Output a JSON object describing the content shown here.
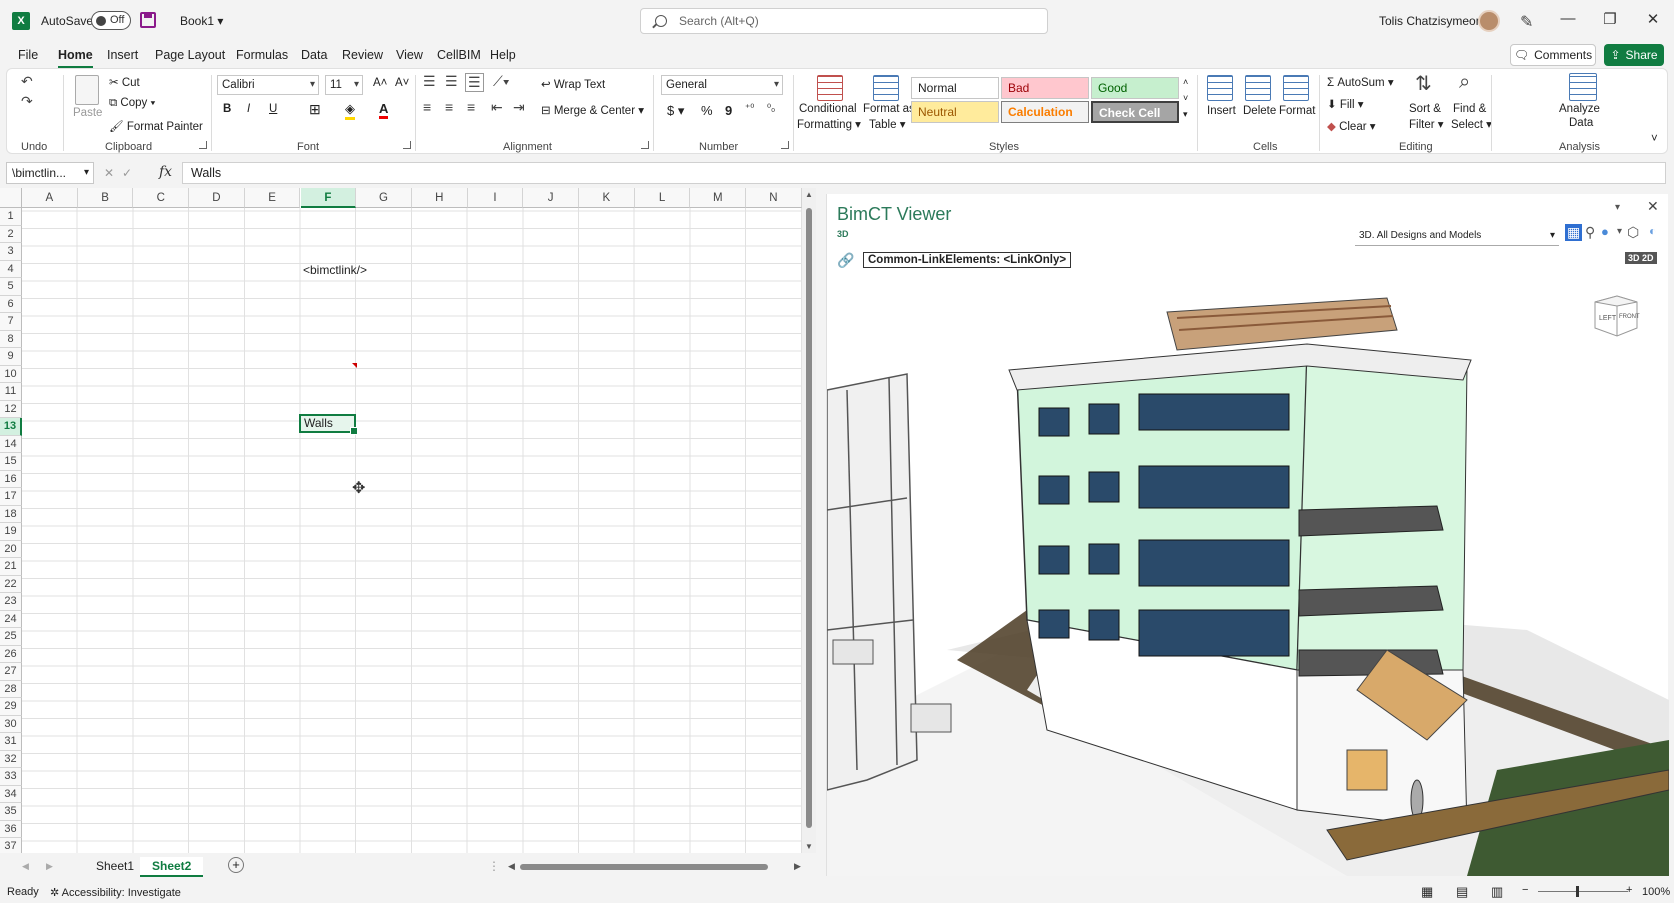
{
  "titlebar": {
    "autosave_label": "AutoSave",
    "autosave_state": "Off",
    "book_title": "Book1",
    "search_placeholder": "Search (Alt+Q)",
    "user_name": "Tolis Chatzisymeon"
  },
  "menu": {
    "tabs": [
      "File",
      "Home",
      "Insert",
      "Page Layout",
      "Formulas",
      "Data",
      "Review",
      "View",
      "CellBIM",
      "Help"
    ],
    "active": "Home",
    "comments_label": "Comments",
    "share_label": "Share"
  },
  "ribbon": {
    "undo_label": "Undo",
    "clipboard": {
      "label": "Clipboard",
      "paste": "Paste",
      "cut": "Cut",
      "copy": "Copy",
      "format_painter": "Format Painter"
    },
    "font": {
      "label": "Font",
      "name": "Calibri",
      "size": "11",
      "bold": "B",
      "italic": "I",
      "underline": "U"
    },
    "alignment": {
      "label": "Alignment",
      "wrap_text": "Wrap Text",
      "merge_center": "Merge & Center"
    },
    "number": {
      "label": "Number",
      "format": "General",
      "currency": "$",
      "percent": "%",
      "comma": "9"
    },
    "styles": {
      "label": "Styles",
      "conditional_1": "Conditional",
      "conditional_2": "Formatting",
      "format_table_1": "Format as",
      "format_table_2": "Table",
      "normal": "Normal",
      "bad": "Bad",
      "good": "Good",
      "neutral": "Neutral",
      "calculation": "Calculation",
      "check_cell": "Check Cell"
    },
    "cells": {
      "label": "Cells",
      "insert": "Insert",
      "delete": "Delete",
      "format": "Format"
    },
    "editing": {
      "label": "Editing",
      "autosum": "AutoSum",
      "fill": "Fill",
      "clear": "Clear",
      "sort_1": "Sort &",
      "sort_2": "Filter",
      "find_1": "Find &",
      "find_2": "Select"
    },
    "analysis": {
      "label": "Analysis",
      "analyze_1": "Analyze",
      "analyze_2": "Data"
    }
  },
  "formula_bar": {
    "name_box": "\\bimctlin...",
    "fx": "fx",
    "value": "Walls"
  },
  "grid": {
    "columns": [
      "A",
      "B",
      "C",
      "D",
      "E",
      "F",
      "G",
      "H",
      "I",
      "J",
      "K",
      "L",
      "M",
      "N"
    ],
    "selected_column": "F",
    "rows": [
      "1",
      "2",
      "3",
      "4",
      "5",
      "6",
      "7",
      "8",
      "9",
      "10",
      "11",
      "12",
      "13",
      "14",
      "15",
      "16",
      "17",
      "18",
      "19",
      "20",
      "21",
      "22",
      "23",
      "24",
      "25",
      "26",
      "27",
      "28",
      "29",
      "30",
      "31",
      "32",
      "33",
      "34",
      "35",
      "36",
      "37"
    ],
    "selected_row": "13",
    "cell_f4": "<bimctlink/>",
    "cell_f13": "Walls"
  },
  "sheets": {
    "tabs": [
      "Sheet1",
      "Sheet2"
    ],
    "active": "Sheet2"
  },
  "status": {
    "ready": "Ready",
    "accessibility": "Accessibility: Investigate",
    "zoom": "100%"
  },
  "viewer": {
    "title": "BimCT Viewer",
    "mode": "3D",
    "select_value": "3D. All Designs and Models",
    "link_label": "Common-LinkElements: <LinkOnly>",
    "badge": "3D 2D",
    "cube_left": "LEFT",
    "cube_front": "FRONT"
  },
  "colors": {
    "excel_green": "#107c41",
    "bad_bg": "#ffc7ce",
    "bad_fg": "#9c0006",
    "good_bg": "#c6efce",
    "good_fg": "#006100",
    "neutral_bg": "#ffeb9c",
    "neutral_fg": "#9c5700",
    "calc_bg": "#f2f2f2",
    "calc_fg": "#fa7d00",
    "check_bg": "#a5a5a5",
    "facade_green": "#d2f5dc"
  }
}
